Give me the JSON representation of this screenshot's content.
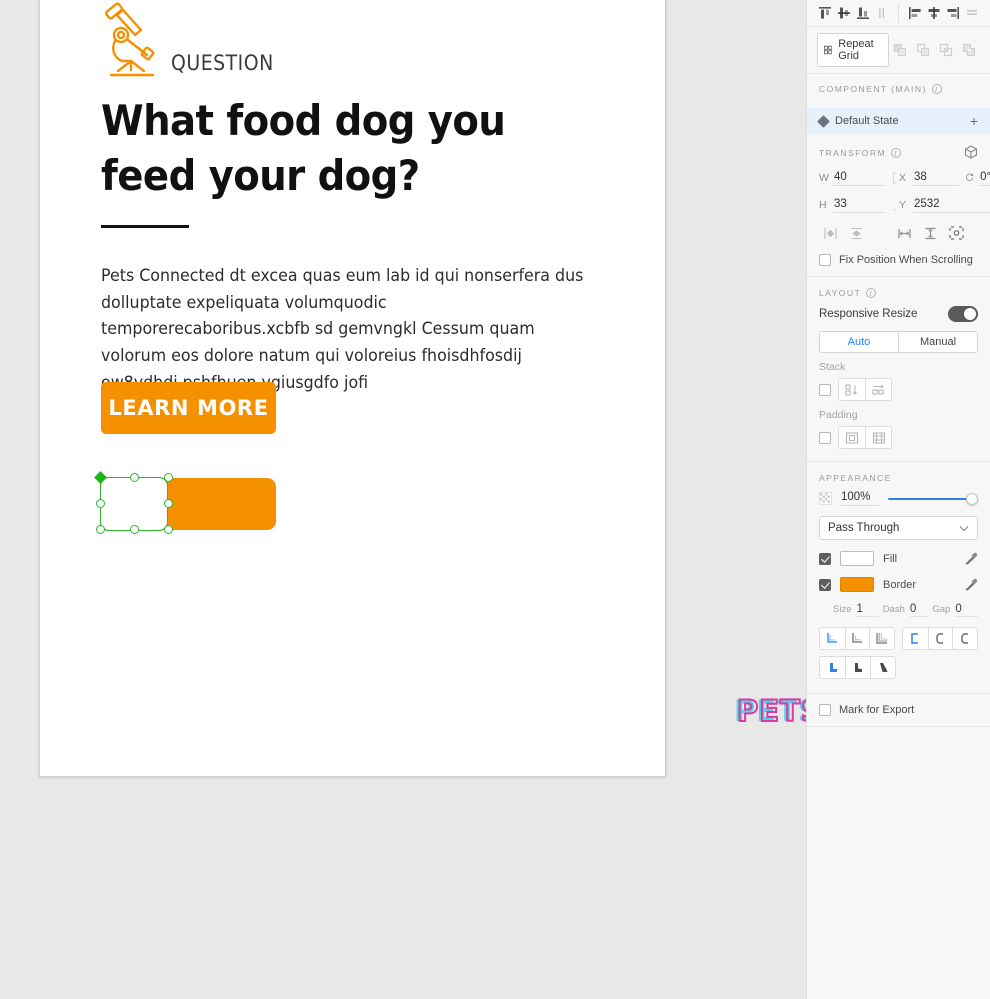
{
  "artboard": {
    "eyebrow": "QUESTION",
    "headline": "What food dog you feed your dog?",
    "body": "Pets Connected dt excea quas eum lab id qui nonserfera dus dolluptate expeliquata volumquodic temporerecaboribus.xcbfb sd gemvngkl Cessum quam volorum eos dolore natum qui voloreius fhoisdhfosdij ow8ydhdj pshfhuen ygiusgdfo jofi",
    "cta_label": "LEARN MORE",
    "watermark": "PETS",
    "accent_color": "#F59000",
    "selection_color": "#2fb52f"
  },
  "panel": {
    "align": {
      "vertical": [
        "align-top-icon",
        "align-middle-icon",
        "align-bottom-icon",
        "distribute-vertical-icon"
      ],
      "horizontal": [
        "align-left-icon",
        "align-center-icon",
        "align-right-icon",
        "distribute-horizontal-icon"
      ]
    },
    "repeat_grid": {
      "label": "Repeat Grid",
      "boolean_ops": [
        "union-icon",
        "subtract-icon",
        "intersect-icon",
        "exclude-icon"
      ]
    },
    "component": {
      "title": "COMPONENT (MAIN)",
      "state_label": "Default State",
      "add_label": "+"
    },
    "transform": {
      "title": "TRANSFORM",
      "w_label": "W",
      "w_value": "40",
      "h_label": "H",
      "h_value": "33",
      "x_label": "X",
      "x_value": "38",
      "y_label": "Y",
      "y_value": "2532",
      "rotation_value": "0°",
      "fix_position_label": "Fix Position When Scrolling",
      "fix_position_checked": false
    },
    "layout": {
      "title": "LAYOUT",
      "responsive_resize_label": "Responsive Resize",
      "responsive_resize_on": true,
      "mode_options": [
        "Auto",
        "Manual"
      ],
      "mode_selected": "Auto",
      "stack_label": "Stack",
      "stack_checked": false,
      "padding_label": "Padding",
      "padding_checked": false
    },
    "appearance": {
      "title": "APPEARANCE",
      "opacity": "100%",
      "blend_mode": "Pass Through",
      "fill_label": "Fill",
      "fill_checked": true,
      "fill_color": "#ffffff",
      "border_label": "Border",
      "border_checked": true,
      "border_color": "#F59000",
      "size_label": "Size",
      "size_value": "1",
      "dash_label": "Dash",
      "dash_value": "0",
      "gap_label": "Gap",
      "gap_value": "0"
    },
    "export": {
      "label": "Mark for Export",
      "checked": false
    }
  }
}
